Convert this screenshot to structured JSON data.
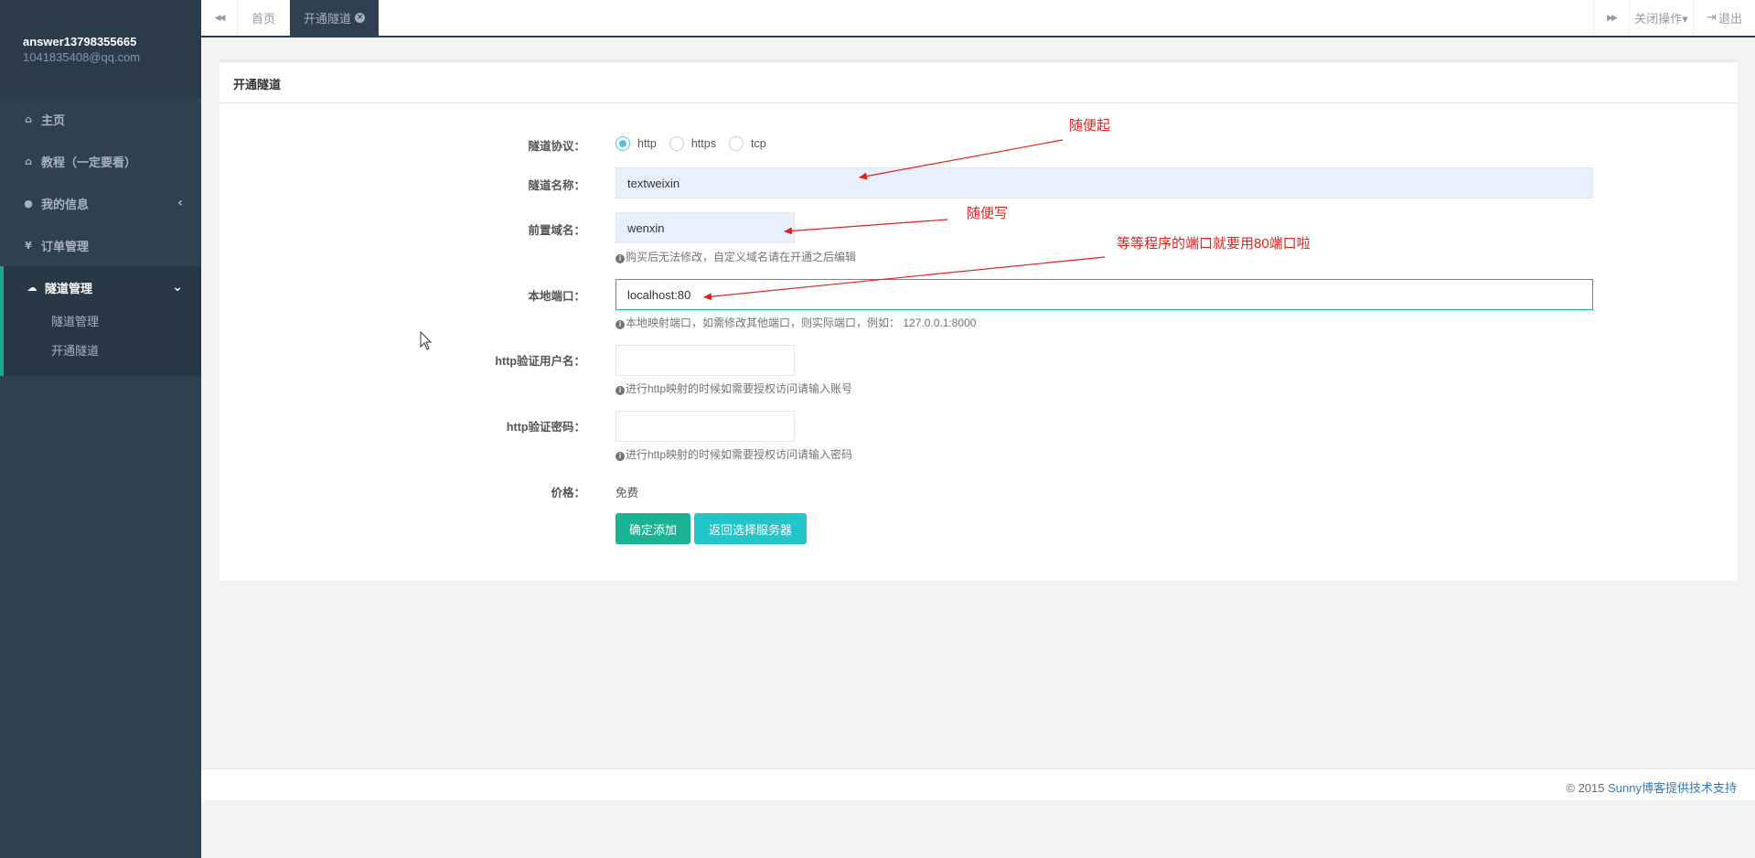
{
  "profile": {
    "username": "answer13798355665",
    "email": "1041835408@qq.com"
  },
  "sidebar": {
    "items": [
      {
        "icon": "home-icon",
        "glyph": "⌂",
        "label": "主页"
      },
      {
        "icon": "home-icon",
        "glyph": "⌂",
        "label": "教程（一定要看）"
      },
      {
        "icon": "user-icon",
        "glyph": "●",
        "label": "我的信息",
        "arrow": "‹"
      },
      {
        "icon": "yen-icon",
        "glyph": "¥",
        "label": "订单管理"
      }
    ],
    "active": {
      "icon": "cloud-icon",
      "glyph": "☁",
      "label": "隧道管理",
      "arrow": "⌄",
      "sub": [
        "隧道管理",
        "开通隧道"
      ]
    }
  },
  "topbar": {
    "back_glyph": "◀◀",
    "fwd_glyph": "▶▶",
    "tabs": [
      {
        "label": "首页"
      },
      {
        "label": "开通隧道",
        "close": "×"
      }
    ],
    "close_ops": "关闭操作▾",
    "logout": "退出",
    "logout_glyph": "⇥"
  },
  "panel": {
    "title": "开通隧道"
  },
  "form": {
    "protocol": {
      "label": "隧道协议：",
      "options": [
        "http",
        "https",
        "tcp"
      ],
      "selected": "http"
    },
    "name": {
      "label": "隧道名称：",
      "value": "textweixin"
    },
    "domain": {
      "label": "前置域名：",
      "value": "wenxin",
      "help": "购买后无法修改，自定义域名请在开通之后编辑"
    },
    "port": {
      "label": "本地端口：",
      "value": "localhost:80",
      "help": "本地映射端口，如需修改其他端口，则实际端口，例如： 127.0.0.1:8000"
    },
    "http_user": {
      "label": "http验证用户名：",
      "value": "",
      "help": "进行http映射的时候如需要授权访问请输入账号"
    },
    "http_pass": {
      "label": "http验证密码：",
      "value": "",
      "help": "进行http映射的时候如需要授权访问请输入密码"
    },
    "price": {
      "label": "价格：",
      "value": "免费"
    },
    "submit_label": "确定添加",
    "back_label": "返回选择服务器",
    "info_glyph": "i"
  },
  "annotations": {
    "a1": "随便起",
    "a2": "随便写",
    "a3": "等等程序的端口就要用80端口啦"
  },
  "footer": {
    "copyright": "© 2015 ",
    "link": "Sunny博客提供技术支持"
  },
  "colors": {
    "sidebar": "#2f4050",
    "accent": "#1ab394",
    "info": "#23c6c8",
    "annotation": "#e0211e"
  }
}
